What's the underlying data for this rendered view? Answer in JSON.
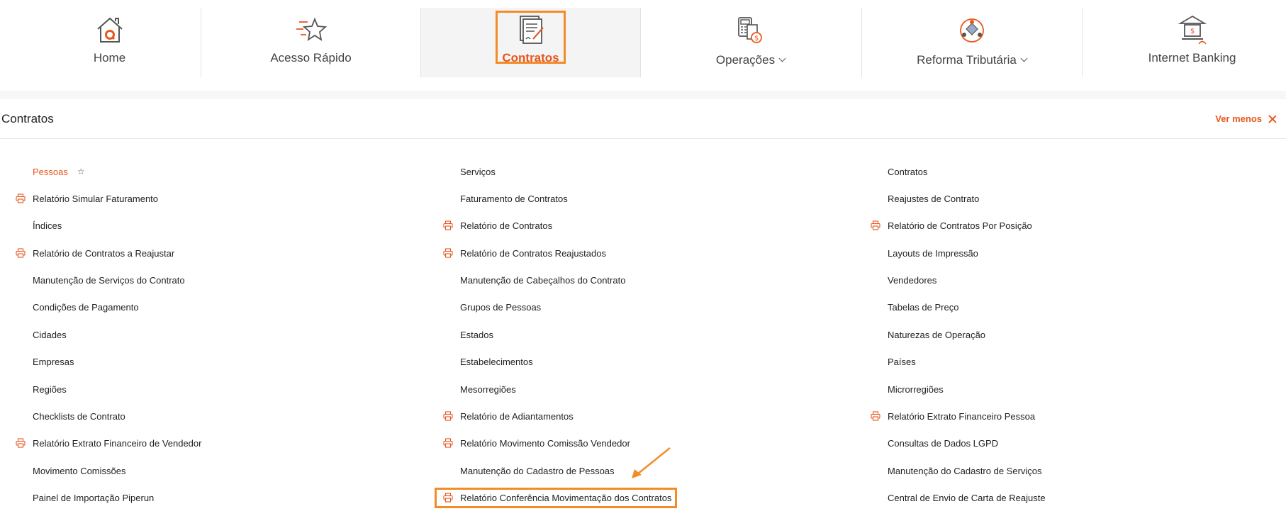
{
  "nav": {
    "items": [
      {
        "label": "Home",
        "icon": "home-icon"
      },
      {
        "label": "Acesso Rápido",
        "icon": "star-icon"
      },
      {
        "label": "Contratos",
        "icon": "contract-icon",
        "active": true
      },
      {
        "label": "Operações",
        "icon": "operations-icon",
        "dropdown": true
      },
      {
        "label": "Reforma Tributária",
        "icon": "tax-reform-icon",
        "dropdown": true
      },
      {
        "label": "Internet Banking",
        "icon": "bank-icon"
      }
    ]
  },
  "section": {
    "title": "Contratos",
    "ver_menos": "Ver menos"
  },
  "menu": {
    "col1": [
      {
        "label": "Pessoas",
        "highlight": true,
        "favorite": true
      },
      {
        "label": "Relatório Simular Faturamento",
        "print": true
      },
      {
        "label": "Índices"
      },
      {
        "label": "Relatório de Contratos a Reajustar",
        "print": true
      },
      {
        "label": "Manutenção de Serviços do Contrato"
      },
      {
        "label": "Condições de Pagamento"
      },
      {
        "label": "Cidades"
      },
      {
        "label": "Empresas"
      },
      {
        "label": "Regiões"
      },
      {
        "label": "Checklists de Contrato"
      },
      {
        "label": "Relatório Extrato Financeiro de Vendedor",
        "print": true
      },
      {
        "label": "Movimento Comissões"
      },
      {
        "label": "Painel de Importação Piperun"
      }
    ],
    "col2": [
      {
        "label": "Serviços"
      },
      {
        "label": "Faturamento de Contratos"
      },
      {
        "label": "Relatório de Contratos",
        "print": true
      },
      {
        "label": "Relatório de Contratos Reajustados",
        "print": true
      },
      {
        "label": "Manutenção de Cabeçalhos do Contrato"
      },
      {
        "label": "Grupos de Pessoas"
      },
      {
        "label": "Estados"
      },
      {
        "label": "Estabelecimentos"
      },
      {
        "label": "Mesorregiões"
      },
      {
        "label": "Relatório de Adiantamentos",
        "print": true
      },
      {
        "label": "Relatório Movimento Comissão Vendedor",
        "print": true
      },
      {
        "label": "Manutenção do Cadastro de Pessoas"
      },
      {
        "label": "Relatório Conferência Movimentação dos Contratos",
        "print": true,
        "annotated": true
      }
    ],
    "col3": [
      {
        "label": "Contratos"
      },
      {
        "label": "Reajustes de Contrato"
      },
      {
        "label": "Relatório de Contratos Por Posição",
        "print": true
      },
      {
        "label": "Layouts de Impressão"
      },
      {
        "label": "Vendedores"
      },
      {
        "label": "Tabelas de Preço"
      },
      {
        "label": "Naturezas de Operação"
      },
      {
        "label": "Países"
      },
      {
        "label": "Microrregiões"
      },
      {
        "label": "Relatório Extrato Financeiro Pessoa",
        "print": true
      },
      {
        "label": "Consultas de Dados LGPD"
      },
      {
        "label": "Manutenção do Cadastro de Serviços"
      },
      {
        "label": "Central de Envio de Carta de Reajuste"
      }
    ]
  },
  "colors": {
    "accent": "#e8571e",
    "annotation": "#f28c28",
    "text": "#222222"
  }
}
